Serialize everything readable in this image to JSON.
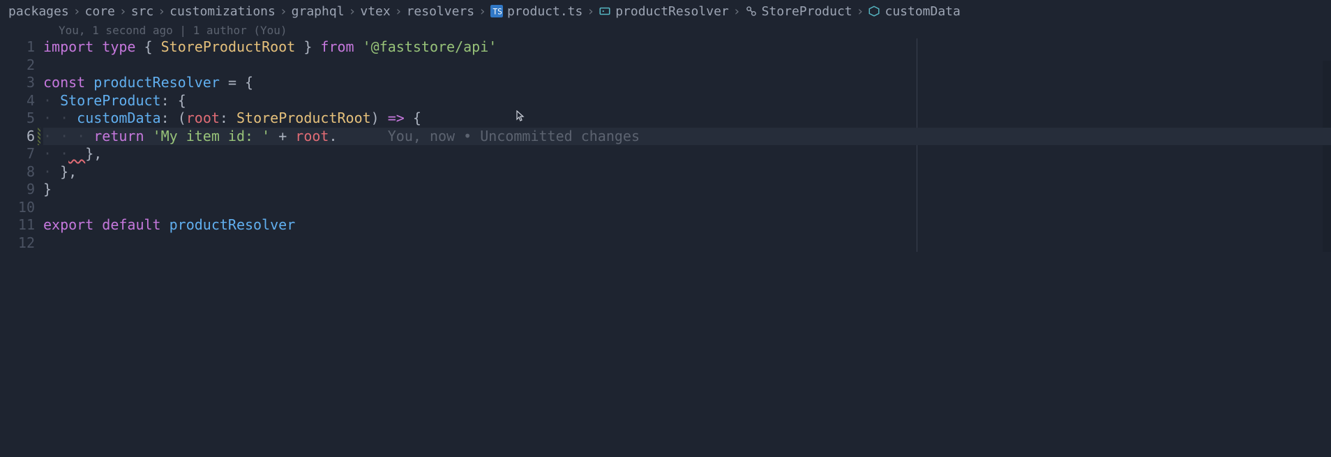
{
  "breadcrumb": {
    "items": [
      {
        "label": "packages",
        "icon": null
      },
      {
        "label": "core",
        "icon": null
      },
      {
        "label": "src",
        "icon": null
      },
      {
        "label": "customizations",
        "icon": null
      },
      {
        "label": "graphql",
        "icon": null
      },
      {
        "label": "vtex",
        "icon": null
      },
      {
        "label": "resolvers",
        "icon": null
      },
      {
        "label": "product.ts",
        "icon": "ts-file-icon"
      },
      {
        "label": "productResolver",
        "icon": "symbol-variable-icon"
      },
      {
        "label": "StoreProduct",
        "icon": "symbol-class-icon"
      },
      {
        "label": "customData",
        "icon": "symbol-field-icon"
      }
    ],
    "separator": "›"
  },
  "blame_header": "You, 1 second ago | 1 author (You)",
  "gitlens_inline": "You, now • Uncommitted changes",
  "current_line": 6,
  "line_count": 12,
  "code": {
    "l1": {
      "kw_import": "import",
      "kw_type": "type",
      "brace_o": "{",
      "type_name": "StoreProductRoot",
      "brace_c": "}",
      "kw_from": "from",
      "pkg": "'@faststore/api'"
    },
    "l3": {
      "kw_const": "const",
      "name": "productResolver",
      "eq": "=",
      "brace": "{"
    },
    "l4": {
      "indent": "·",
      "name": "StoreProduct",
      "colon": ":",
      "brace": "{"
    },
    "l5": {
      "indent": "·",
      "name": "customData",
      "colon": ":",
      "paren_o": "(",
      "param": "root",
      "colon2": ":",
      "type": "StoreProductRoot",
      "paren_c": ")",
      "arrow": "=>",
      "brace": "{"
    },
    "l6": {
      "indent": "·",
      "kw_return": "return",
      "str": "'My item id: '",
      "plus": "+",
      "obj": "root",
      "dot": "."
    },
    "l7": {
      "indent": "·",
      "close": "},",
      "err": "  "
    },
    "l8": {
      "indent": "·",
      "close": "},"
    },
    "l9": {
      "close": "}"
    },
    "l11": {
      "kw_export": "export",
      "kw_default": "default",
      "name": "productResolver"
    }
  }
}
